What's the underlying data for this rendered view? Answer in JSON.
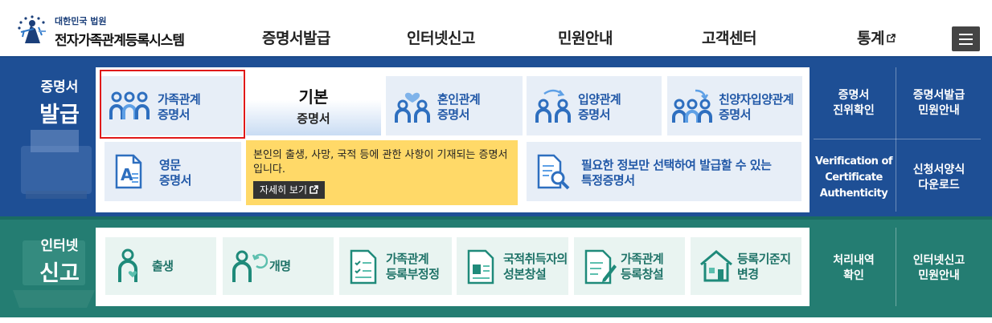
{
  "header": {
    "logo_small": "대한민국 법원",
    "logo_big": "전자가족관계등록시스템",
    "nav": [
      {
        "label": "증명서발급"
      },
      {
        "label": "인터넷신고"
      },
      {
        "label": "민원안내"
      },
      {
        "label": "고객센터"
      },
      {
        "label": "통계",
        "external": true
      }
    ],
    "menu_icon": "hamburger-icon"
  },
  "certificate": {
    "section_title_small": "증명서",
    "section_title_big": "발급",
    "cards": [
      {
        "line1": "가족관계",
        "line2": "증명서",
        "icon": "family-icon",
        "selected": true
      },
      {
        "line1": "혼인관계",
        "line2": "증명서",
        "icon": "couple-heart-icon"
      },
      {
        "line1": "입양관계",
        "line2": "증명서",
        "icon": "adoption-icon"
      },
      {
        "line1": "친양자입양관계",
        "line2": "증명서",
        "icon": "full-adoption-icon"
      },
      {
        "line1": "영문",
        "line2": "증명서",
        "icon": "english-document-icon"
      },
      {
        "line1": "필요한 정보만 선택하여 발급할 수 있는",
        "line2": "특정증명서",
        "icon": "search-document-icon"
      }
    ],
    "basic_tab": {
      "title": "기본",
      "subtitle": "증명서"
    },
    "tooltip": {
      "text": "본인의 출생, 사망, 국적 등에 관한 사항이 기재되는 증명서입니다.",
      "more": "자세히 보기"
    },
    "side_links": [
      {
        "label": "증명서\n진위확인"
      },
      {
        "label": "증명서발급\n민원안내"
      },
      {
        "label": "Verification of\nCertificate\nAuthenticity"
      },
      {
        "label": "신청서양식\n다운로드"
      }
    ]
  },
  "internet_report": {
    "section_title_small": "인터넷",
    "section_title_big": "신고",
    "cards": [
      {
        "line1": "출생",
        "icon": "birth-icon"
      },
      {
        "line1": "개명",
        "icon": "rename-icon"
      },
      {
        "line1": "가족관계",
        "line2": "등록부정정",
        "icon": "checklist-icon"
      },
      {
        "line1": "국적취득자의",
        "line2": "성본창설",
        "icon": "id-document-icon"
      },
      {
        "line1": "가족관계",
        "line2": "등록창설",
        "icon": "document-pen-icon"
      },
      {
        "line1": "등록기준지",
        "line2": "변경",
        "icon": "house-icon"
      }
    ],
    "side_links": [
      {
        "label": "처리내역\n확인"
      },
      {
        "label": "인터넷신고\n민원안내"
      }
    ]
  },
  "colors": {
    "blue_band": "#1e4f95",
    "green_band": "#247d72",
    "card_blue": "#e7eef7",
    "card_green": "#e9f4f1",
    "accent_blue": "#2158a7",
    "accent_green": "#1f7368",
    "selection_border": "#e01919",
    "tooltip": "#ffd968"
  }
}
